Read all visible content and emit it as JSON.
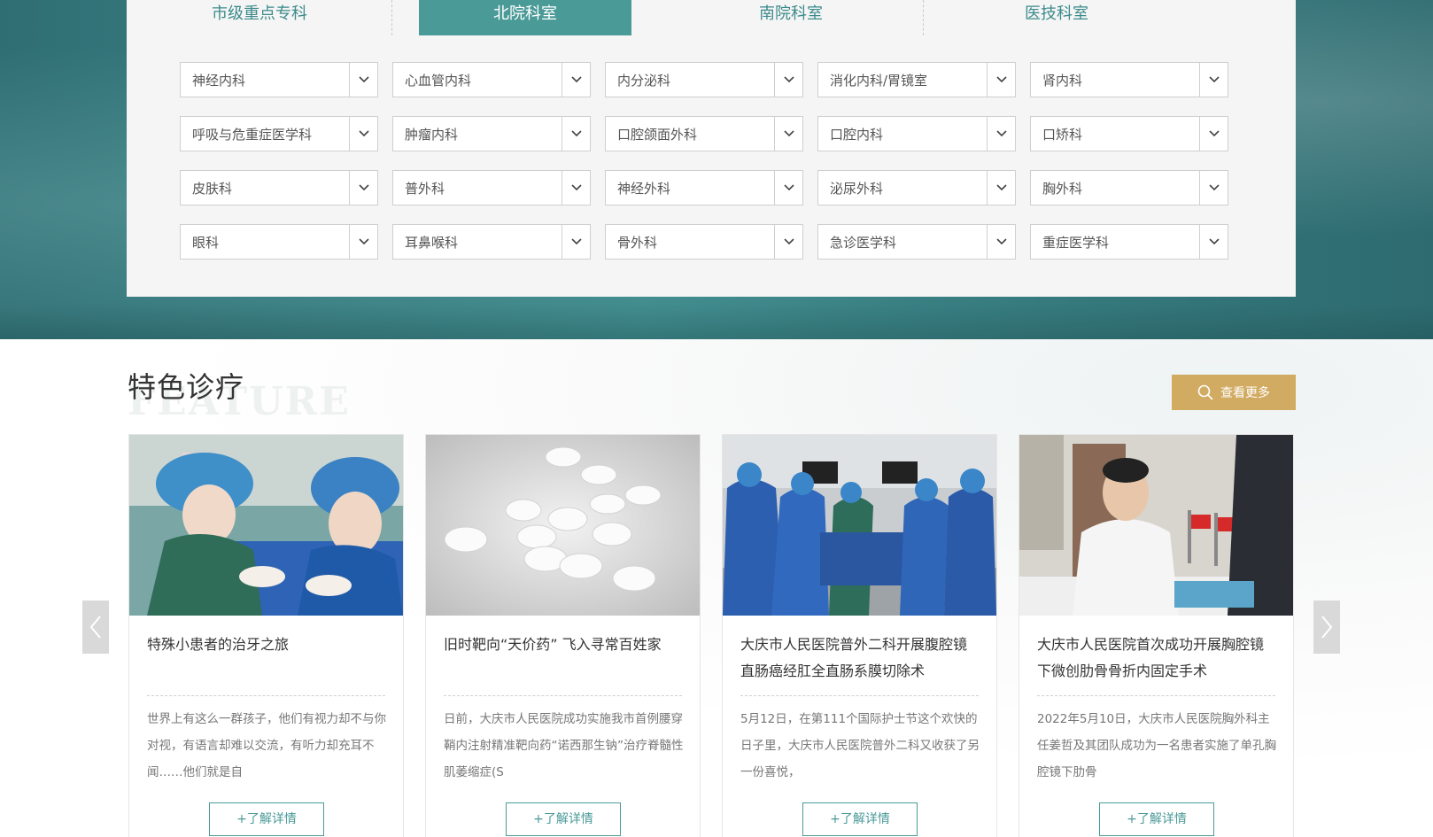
{
  "tabs": [
    {
      "label": "市级重点专科",
      "active": false
    },
    {
      "label": "北院科室",
      "active": true
    },
    {
      "label": "南院科室",
      "active": false
    },
    {
      "label": "医技科室",
      "active": false
    }
  ],
  "departments": [
    "神经内科",
    "心血管内科",
    "内分泌科",
    "消化内科/胃镜室",
    "肾内科",
    "呼吸与危重症医学科",
    "肿瘤内科",
    "口腔颌面外科",
    "口腔内科",
    "口矫科",
    "皮肤科",
    "普外科",
    "神经外科",
    "泌尿外科",
    "胸外科",
    "眼科",
    "耳鼻喉科",
    "骨外科",
    "急诊医学科",
    "重症医学科"
  ],
  "feature": {
    "title": "特色诊疗",
    "subtitle": "FEATURE",
    "more_label": "查看更多",
    "accent": "#d2ab62",
    "teal": "#4a9a98"
  },
  "cards": [
    {
      "title": "特殊小患者的治牙之旅",
      "desc": "世界上有这么一群孩子，他们有视力却不与你对视，有语言却难以交流，有听力却充耳不闻……他们就是自",
      "button": "+了解详情",
      "image": "dental-surgery-photo"
    },
    {
      "title": "旧时靶向“天价药” 飞入寻常百姓家",
      "desc": "日前，大庆市人民医院成功实施我市首例腰穿鞘内注射精准靶向药“诺西那生钠”治疗脊髓性肌萎缩症(S",
      "button": "+了解详情",
      "image": "pills-photo"
    },
    {
      "title": "大庆市人民医院普外二科开展腹腔镜直肠癌经肛全直肠系膜切除术",
      "desc": "5月12日，在第111个国际护士节这个欢快的日子里，大庆市人民医院普外二科又收获了另一份喜悦，",
      "button": "+了解详情",
      "image": "operating-room-photo"
    },
    {
      "title": "大庆市人民医院首次成功开展胸腔镜下微创肋骨骨折内固定手术",
      "desc": "2022年5月10日，大庆市人民医院胸外科主任姜哲及其团队成功为一名患者实施了单孔胸腔镜下肋骨",
      "button": "+了解详情",
      "image": "doctor-office-photo"
    }
  ]
}
